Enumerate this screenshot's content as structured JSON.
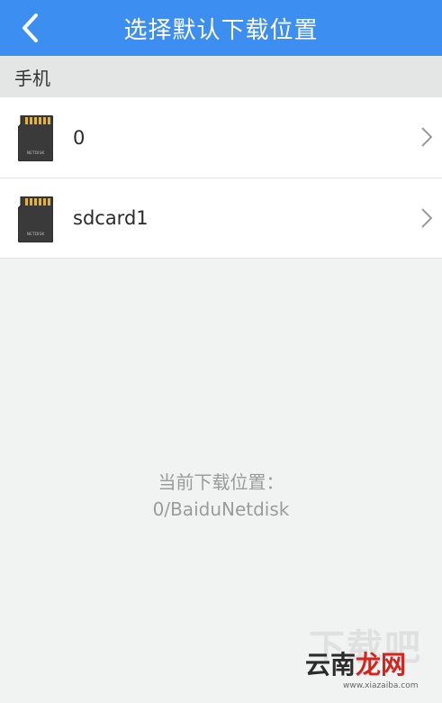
{
  "header": {
    "title": "选择默认下载位置",
    "back_icon": "chevron-left-icon",
    "background": "#3d8ef1"
  },
  "section": {
    "title": "手机"
  },
  "storage_items": [
    {
      "label": "0",
      "icon": "sd-card-icon",
      "icon_text": "NETDISK"
    },
    {
      "label": "sdcard1",
      "icon": "sd-card-icon",
      "icon_text": "NETDISK"
    }
  ],
  "current_location": {
    "label": "当前下载位置：",
    "path": "0/BaiduNetdisk"
  },
  "watermark": {
    "top_text": "下载吧",
    "main_text": "云南",
    "main_text_red": "龙网",
    "sub_text": "www.xiazaiba.com"
  }
}
